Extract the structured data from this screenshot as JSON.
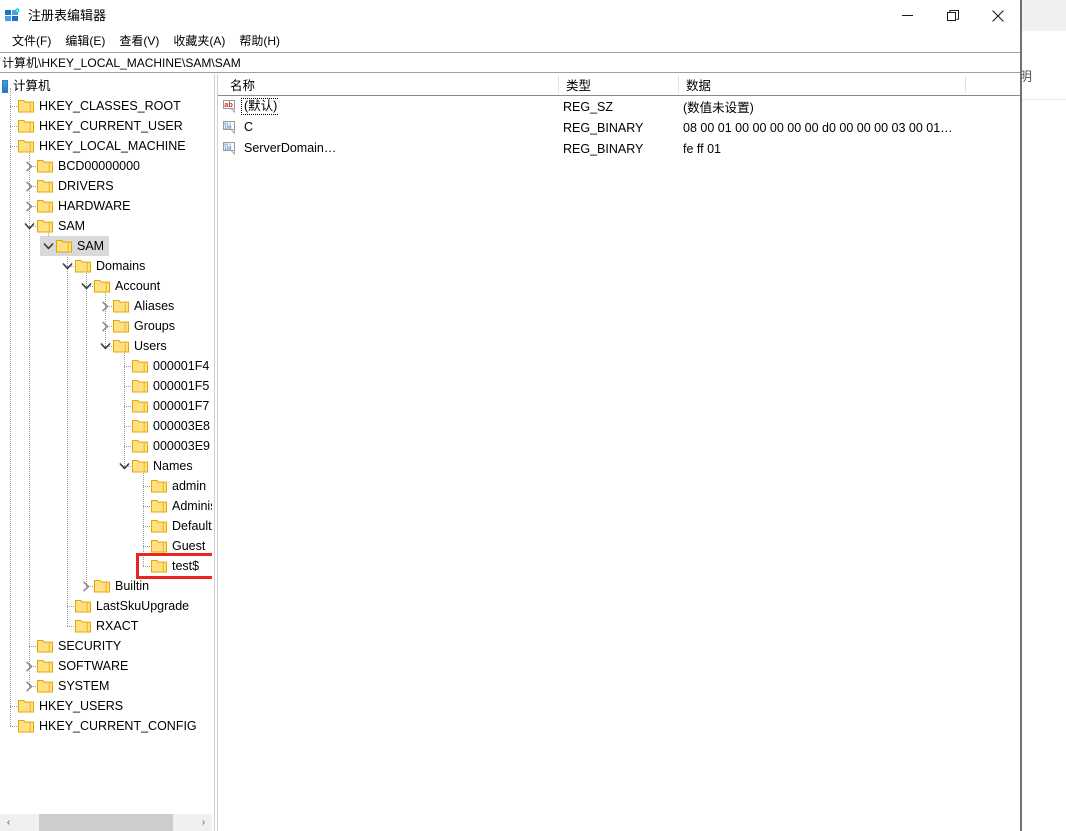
{
  "window": {
    "title": "注册表编辑器",
    "app_icon": "registry-editor-icon",
    "controls": {
      "minimize": "minimize-icon",
      "restore": "restore-icon",
      "close": "close-icon"
    }
  },
  "menubar": [
    {
      "label": "文件(F)",
      "name": "menu-file"
    },
    {
      "label": "编辑(E)",
      "name": "menu-edit"
    },
    {
      "label": "查看(V)",
      "name": "menu-view"
    },
    {
      "label": "收藏夹(A)",
      "name": "menu-favorites"
    },
    {
      "label": "帮助(H)",
      "name": "menu-help"
    }
  ],
  "addressbar": {
    "path": "计算机\\HKEY_LOCAL_MACHINE\\SAM\\SAM"
  },
  "tree": {
    "root_label": "计算机",
    "selected_key": "SAM",
    "highlighted_key": "test$",
    "nodes": [
      {
        "label": "HKEY_CLASSES_ROOT",
        "depth": 1,
        "twisty": "none",
        "selected": false
      },
      {
        "label": "HKEY_CURRENT_USER",
        "depth": 1,
        "twisty": "none",
        "selected": false
      },
      {
        "label": "HKEY_LOCAL_MACHINE",
        "depth": 1,
        "twisty": "none",
        "selected": false
      },
      {
        "label": "BCD00000000",
        "depth": 2,
        "twisty": "collapsed",
        "selected": false
      },
      {
        "label": "DRIVERS",
        "depth": 2,
        "twisty": "collapsed",
        "selected": false
      },
      {
        "label": "HARDWARE",
        "depth": 2,
        "twisty": "collapsed",
        "selected": false
      },
      {
        "label": "SAM",
        "depth": 2,
        "twisty": "expanded",
        "selected": false
      },
      {
        "label": "SAM",
        "depth": 3,
        "twisty": "expanded",
        "selected": true
      },
      {
        "label": "Domains",
        "depth": 4,
        "twisty": "expanded",
        "selected": false
      },
      {
        "label": "Account",
        "depth": 5,
        "twisty": "expanded",
        "selected": false
      },
      {
        "label": "Aliases",
        "depth": 6,
        "twisty": "collapsed",
        "selected": false
      },
      {
        "label": "Groups",
        "depth": 6,
        "twisty": "collapsed",
        "selected": false
      },
      {
        "label": "Users",
        "depth": 6,
        "twisty": "expanded",
        "selected": false
      },
      {
        "label": "000001F4",
        "depth": 7,
        "twisty": "none",
        "selected": false
      },
      {
        "label": "000001F5",
        "depth": 7,
        "twisty": "none",
        "selected": false
      },
      {
        "label": "000001F7",
        "depth": 7,
        "twisty": "none",
        "selected": false
      },
      {
        "label": "000003E8",
        "depth": 7,
        "twisty": "none",
        "selected": false
      },
      {
        "label": "000003E9",
        "depth": 7,
        "twisty": "none",
        "selected": false
      },
      {
        "label": "Names",
        "depth": 7,
        "twisty": "expanded",
        "selected": false
      },
      {
        "label": "admin",
        "depth": 8,
        "twisty": "none",
        "selected": false
      },
      {
        "label": "Administr",
        "depth": 8,
        "twisty": "none",
        "selected": false
      },
      {
        "label": "DefaultAc",
        "depth": 8,
        "twisty": "none",
        "selected": false
      },
      {
        "label": "Guest",
        "depth": 8,
        "twisty": "none",
        "selected": false
      },
      {
        "label": "test$",
        "depth": 8,
        "twisty": "none",
        "selected": false
      },
      {
        "label": "Builtin",
        "depth": 5,
        "twisty": "collapsed",
        "selected": false
      },
      {
        "label": "LastSkuUpgrade",
        "depth": 4,
        "twisty": "none",
        "selected": false
      },
      {
        "label": "RXACT",
        "depth": 4,
        "twisty": "none",
        "selected": false
      },
      {
        "label": "SECURITY",
        "depth": 2,
        "twisty": "none",
        "selected": false
      },
      {
        "label": "SOFTWARE",
        "depth": 2,
        "twisty": "collapsed",
        "selected": false
      },
      {
        "label": "SYSTEM",
        "depth": 2,
        "twisty": "collapsed",
        "selected": false
      },
      {
        "label": "HKEY_USERS",
        "depth": 1,
        "twisty": "none",
        "selected": false
      },
      {
        "label": "HKEY_CURRENT_CONFIG",
        "depth": 1,
        "twisty": "none",
        "selected": false
      }
    ],
    "hscroll": {
      "left_arrow": "‹",
      "right_arrow": "›"
    }
  },
  "values": {
    "columns": [
      {
        "label": "名称",
        "name": "column-name"
      },
      {
        "label": "类型",
        "name": "column-type"
      },
      {
        "label": "数据",
        "name": "column-data"
      }
    ],
    "rows": [
      {
        "name": "(默认)",
        "type": "REG_SZ",
        "data": "(数值未设置)",
        "icon": "string-value-icon",
        "focused": true
      },
      {
        "name": "C",
        "type": "REG_BINARY",
        "data": "08 00 01 00 00 00 00 00 d0 00 00 00 03 00 01…",
        "icon": "binary-value-icon",
        "focused": false
      },
      {
        "name": "ServerDomain…",
        "type": "REG_BINARY",
        "data": "fe ff 01",
        "icon": "binary-value-icon",
        "focused": false
      }
    ]
  },
  "background_window": {
    "partial_text": "明"
  },
  "colors": {
    "folder_fill": "#ffe082",
    "folder_edge": "#e3a700",
    "highlight_red": "#e8251f",
    "selection_gray": "#d9d9d9",
    "accent_blue": "#1b78c8"
  }
}
